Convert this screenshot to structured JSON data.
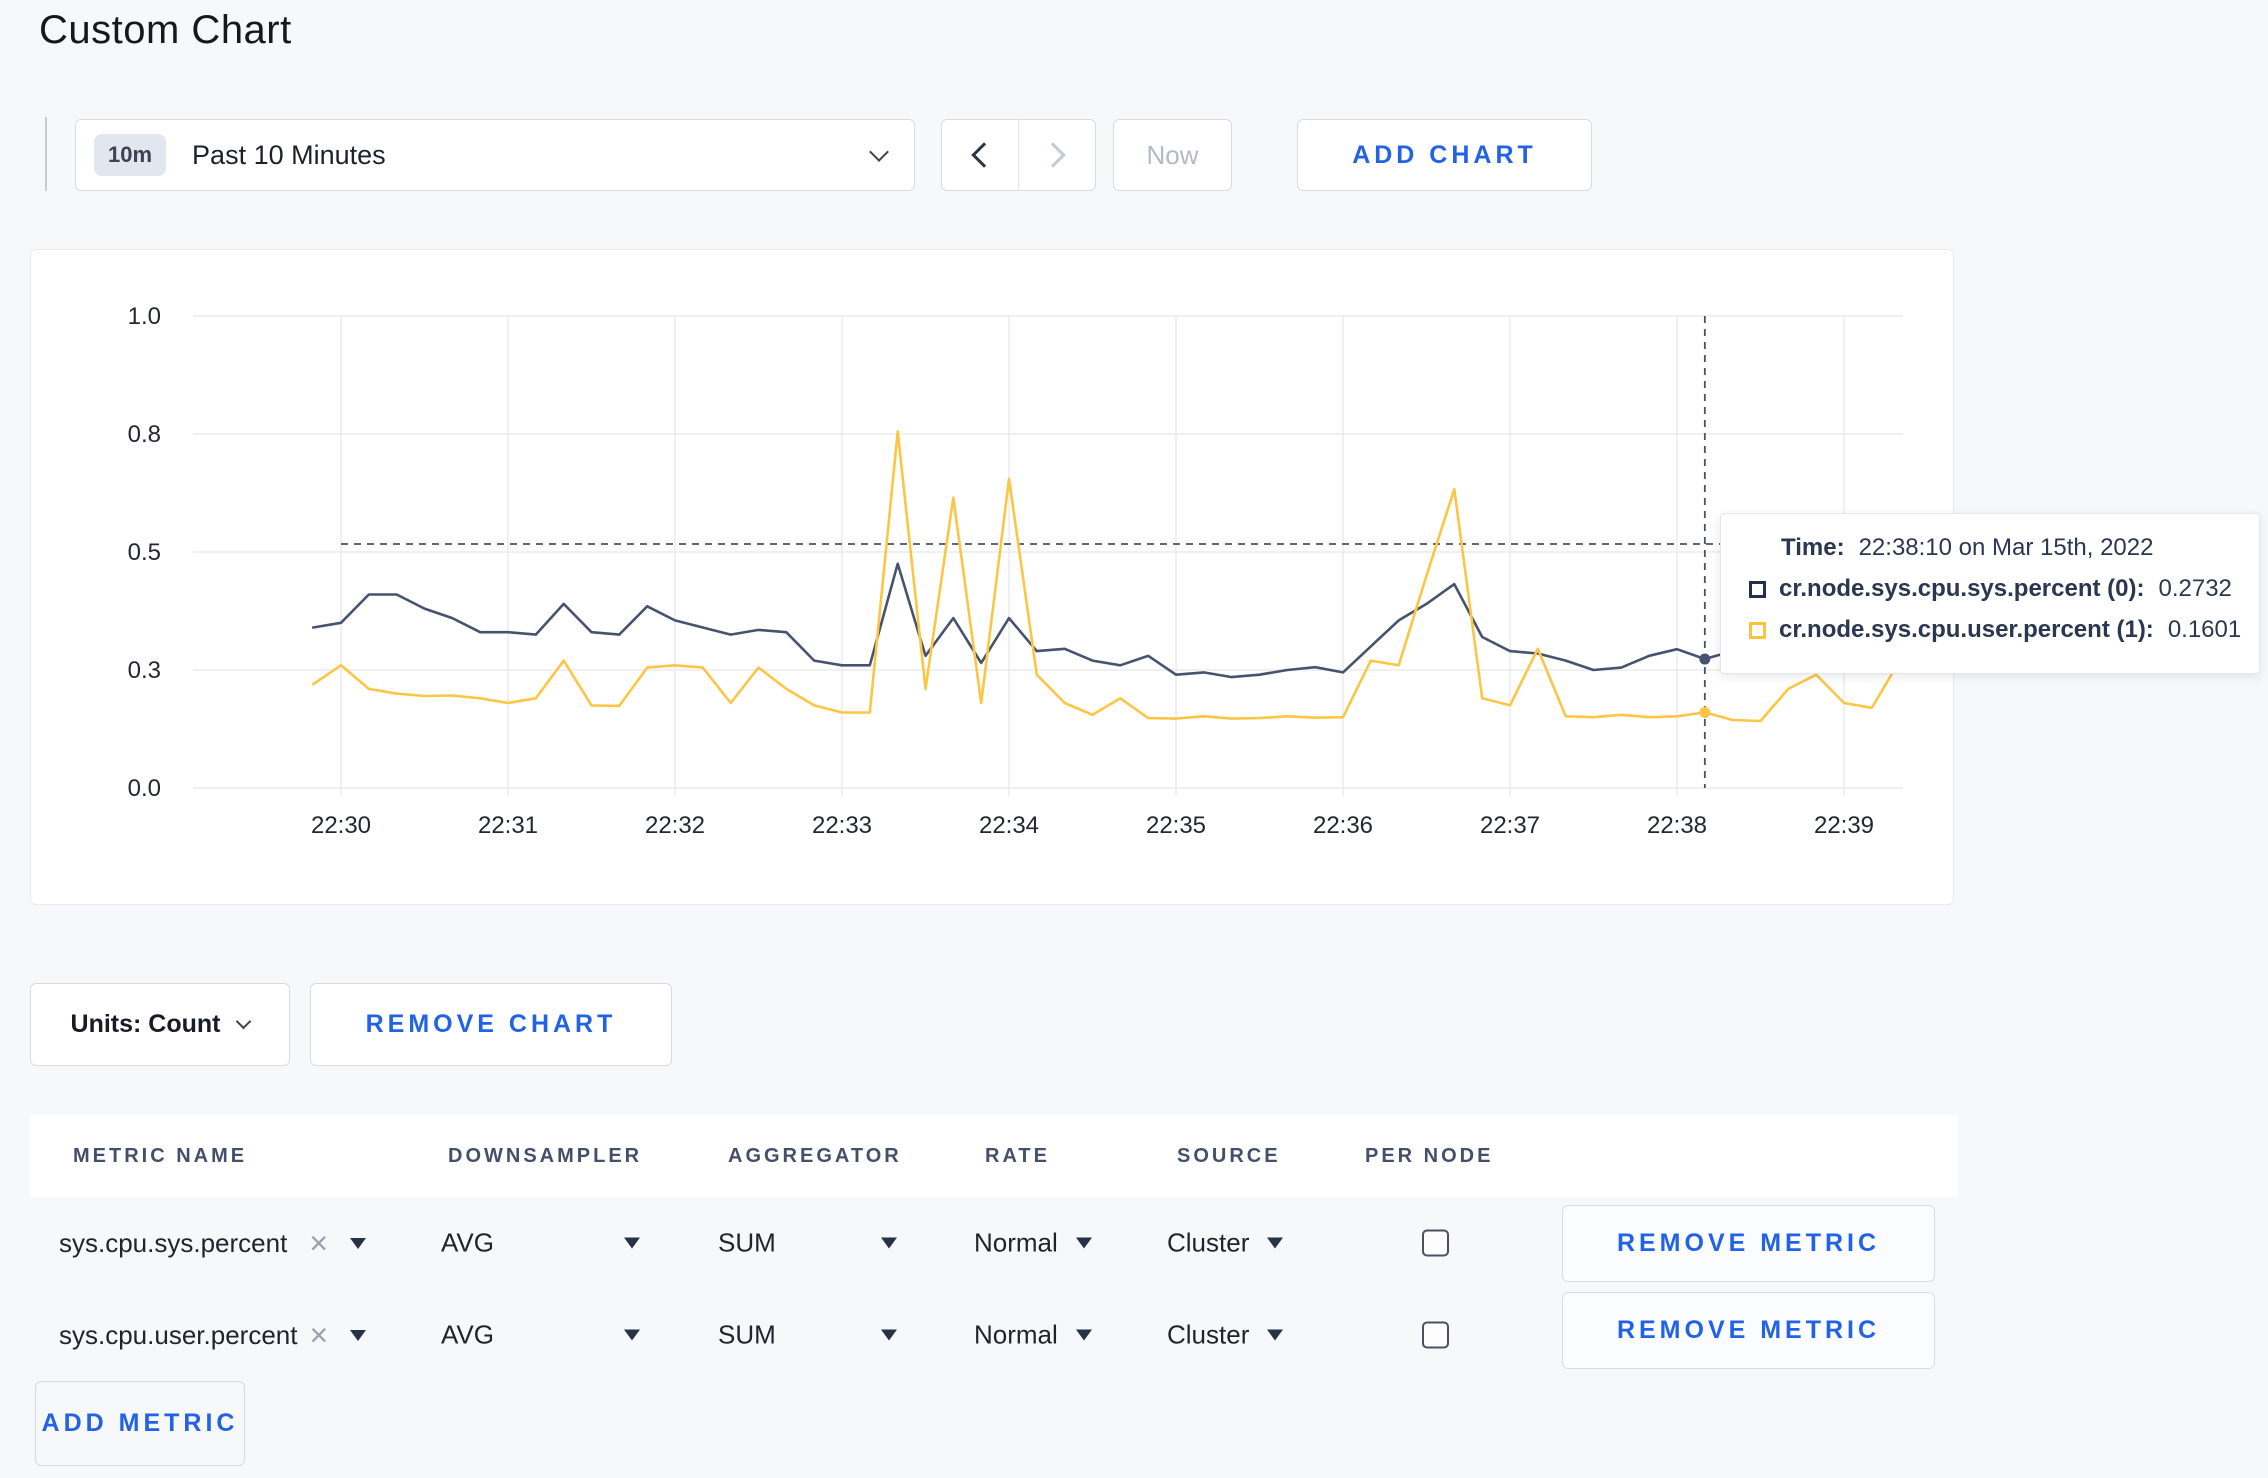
{
  "page": {
    "title": "Custom Chart"
  },
  "toolbar": {
    "time_range_badge": "10m",
    "time_range_label": "Past 10 Minutes",
    "now_label": "Now",
    "add_chart_label": "ADD CHART"
  },
  "chart_controls": {
    "units_label": "Units: Count",
    "remove_chart_label": "REMOVE CHART"
  },
  "tooltip": {
    "time_label": "Time:",
    "time_value": "22:38:10 on Mar 15th, 2022",
    "series": [
      {
        "label": "cr.node.sys.cpu.sys.percent (0):",
        "value": "0.2732",
        "color": "#232f4b"
      },
      {
        "label": "cr.node.sys.cpu.user.percent (1):",
        "value": "0.1601",
        "color": "#fcc23c"
      }
    ]
  },
  "chart_data": {
    "type": "line",
    "title": "",
    "xlabel": "",
    "ylabel": "",
    "ylim": [
      0,
      1
    ],
    "grid": true,
    "x_ticks": [
      "22:30",
      "22:31",
      "22:32",
      "22:33",
      "22:34",
      "22:35",
      "22:36",
      "22:37",
      "22:38",
      "22:39"
    ],
    "y_ticks": [
      "1.0",
      "0.8",
      "0.5",
      "0.3",
      "0.0"
    ],
    "y_tick_values": [
      1.0,
      0.75,
      0.5,
      0.25,
      0.0
    ],
    "x_start_seconds": -10,
    "x_step_seconds": 10,
    "series": [
      {
        "name": "cr.node.sys.cpu.sys.percent",
        "color": "#47536e",
        "values": [
          0.34,
          0.35,
          0.41,
          0.41,
          0.38,
          0.36,
          0.33,
          0.33,
          0.325,
          0.39,
          0.33,
          0.325,
          0.385,
          0.355,
          0.34,
          0.325,
          0.335,
          0.33,
          0.27,
          0.26,
          0.26,
          0.475,
          0.28,
          0.36,
          0.265,
          0.36,
          0.29,
          0.295,
          0.27,
          0.26,
          0.28,
          0.24,
          0.245,
          0.235,
          0.24,
          0.25,
          0.256,
          0.245,
          0.3,
          0.355,
          0.39,
          0.432,
          0.32,
          0.29,
          0.285,
          0.27,
          0.25,
          0.255,
          0.28,
          0.294,
          0.2732,
          0.29,
          0.31,
          0.32,
          0.3,
          0.3,
          0.31,
          0.3
        ]
      },
      {
        "name": "cr.node.sys.cpu.user.percent",
        "color": "#fcc644",
        "values": [
          0.22,
          0.26,
          0.21,
          0.2,
          0.195,
          0.196,
          0.19,
          0.18,
          0.19,
          0.27,
          0.175,
          0.174,
          0.255,
          0.26,
          0.255,
          0.18,
          0.255,
          0.21,
          0.175,
          0.16,
          0.16,
          0.755,
          0.21,
          0.615,
          0.18,
          0.655,
          0.24,
          0.18,
          0.155,
          0.19,
          0.148,
          0.147,
          0.152,
          0.147,
          0.148,
          0.152,
          0.149,
          0.15,
          0.27,
          0.26,
          0.45,
          0.633,
          0.19,
          0.175,
          0.295,
          0.152,
          0.15,
          0.155,
          0.15,
          0.152,
          0.1601,
          0.144,
          0.142,
          0.21,
          0.24,
          0.18,
          0.17,
          0.27
        ]
      }
    ],
    "crosshair": {
      "time": "22:38:10",
      "x_seconds": 490,
      "hline_value": 0.517,
      "points": [
        {
          "series": 0,
          "value": 0.2732
        },
        {
          "series": 1,
          "value": 0.1601
        }
      ]
    }
  },
  "metrics_table": {
    "headers": [
      "METRIC NAME",
      "DOWNSAMPLER",
      "AGGREGATOR",
      "RATE",
      "SOURCE",
      "PER NODE"
    ],
    "remove_metric_label": "REMOVE METRIC",
    "add_metric_label": "ADD METRIC",
    "rows": [
      {
        "metric": "sys.cpu.sys.percent",
        "downsampler": "AVG",
        "aggregator": "SUM",
        "rate": "Normal",
        "source": "Cluster",
        "per_node_checked": false
      },
      {
        "metric": "sys.cpu.user.percent",
        "downsampler": "AVG",
        "aggregator": "SUM",
        "rate": "Normal",
        "source": "Cluster",
        "per_node_checked": false
      }
    ]
  }
}
